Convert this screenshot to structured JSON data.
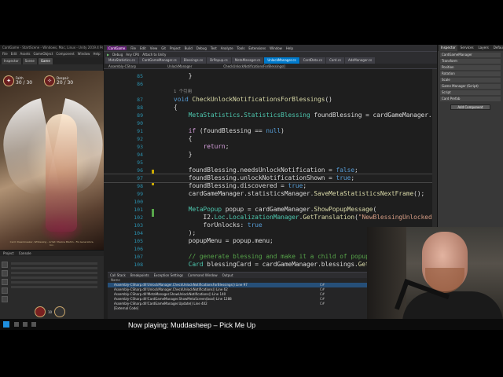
{
  "unity": {
    "title": "CardGame - StartScene - Windows, Mac, Linux - Unity 2019.4 Personal <DX11>",
    "menu": [
      "File",
      "Edit",
      "Assets",
      "GameObject",
      "Component",
      "Window",
      "Help"
    ],
    "tabs": [
      "Inspector",
      "Scene",
      "Game"
    ],
    "hud_left_name": "Faith",
    "hud_left_value": "30 / 30",
    "hud_right_name": "Despair",
    "hud_right_value": "20 / 30",
    "caption": "Card: Dawnbreaker, Whitewing - Artist: Maxine Blahm - FG Generators, Inc.",
    "project_tabs": [
      "Project",
      "Console"
    ],
    "bottom_hud_value": "10"
  },
  "vs": {
    "title_badge": "CardGame",
    "menu": [
      "File",
      "Edit",
      "View",
      "Git",
      "Project",
      "Build",
      "Debug",
      "Test",
      "Analyze",
      "Tools",
      "Extensions",
      "Window",
      "Help"
    ],
    "toolbar": [
      "Debug",
      "Any CPU",
      "Attach to Unity"
    ],
    "doc_tabs": [
      "MetaStatistics.cs",
      "CardGameManager.cs",
      "Blessings.cs",
      "DrPopup.cs",
      "MetaManager.cs",
      "UnlockManager.cs",
      "CardData.cs",
      "Card.cs",
      "AdsManager.cs"
    ],
    "active_doc_tab_index": 5,
    "nav": [
      "Assembly-CSharp",
      "UnlockManager",
      "CheckUnlockNotificationsForBlessings()"
    ],
    "ref_hint": "1 个引用",
    "lines": [
      {
        "n": "85",
        "segs": [
          {
            "c": "",
            "t": "    }"
          }
        ]
      },
      {
        "n": "86",
        "segs": [
          {
            "c": "",
            "t": ""
          }
        ]
      },
      {
        "n": "87",
        "segs": [
          {
            "c": "kw",
            "t": "void "
          },
          {
            "c": "fn",
            "t": "CheckUnlockNotificationsForBlessings"
          },
          {
            "c": "",
            "t": "()"
          }
        ]
      },
      {
        "n": "88",
        "segs": [
          {
            "c": "",
            "t": "{"
          }
        ]
      },
      {
        "n": "89",
        "segs": [
          {
            "c": "",
            "t": "    "
          },
          {
            "c": "ty",
            "t": "MetaStatistics"
          },
          {
            "c": "",
            "t": "."
          },
          {
            "c": "ty",
            "t": "StatisticsBlessing"
          },
          {
            "c": "",
            "t": " foundBlessing = cardGameManager.statisticsMa"
          }
        ]
      },
      {
        "n": "90",
        "segs": [
          {
            "c": "",
            "t": ""
          }
        ]
      },
      {
        "n": "91",
        "segs": [
          {
            "c": "",
            "t": "    "
          },
          {
            "c": "kw2",
            "t": "if"
          },
          {
            "c": "",
            "t": " (foundBlessing == "
          },
          {
            "c": "kw",
            "t": "null"
          },
          {
            "c": "",
            "t": ")"
          }
        ]
      },
      {
        "n": "92",
        "segs": [
          {
            "c": "",
            "t": "    {"
          }
        ]
      },
      {
        "n": "93",
        "segs": [
          {
            "c": "",
            "t": "        "
          },
          {
            "c": "kw2",
            "t": "return"
          },
          {
            "c": "",
            "t": ";"
          }
        ]
      },
      {
        "n": "94",
        "segs": [
          {
            "c": "",
            "t": "    }"
          }
        ]
      },
      {
        "n": "95",
        "segs": [
          {
            "c": "",
            "t": ""
          }
        ]
      },
      {
        "n": "96",
        "segs": [
          {
            "c": "",
            "t": "    foundBlessing.needsUnlockNotification = "
          },
          {
            "c": "kw",
            "t": "false"
          },
          {
            "c": "",
            "t": ";"
          }
        ]
      },
      {
        "n": "97",
        "segs": [
          {
            "c": "",
            "t": "    foundBlessing.unlockNotificationShown = "
          },
          {
            "c": "kw",
            "t": "true"
          },
          {
            "c": "",
            "t": ";"
          }
        ]
      },
      {
        "n": "98",
        "segs": [
          {
            "c": "",
            "t": "    foundBlessing.discovered = "
          },
          {
            "c": "kw",
            "t": "true"
          },
          {
            "c": "",
            "t": ";"
          }
        ]
      },
      {
        "n": "99",
        "segs": [
          {
            "c": "",
            "t": "    cardGameManager.statisticsManager."
          },
          {
            "c": "fn",
            "t": "SaveMetaStatisticsNextFrame"
          },
          {
            "c": "",
            "t": "();"
          }
        ]
      },
      {
        "n": "100",
        "segs": [
          {
            "c": "",
            "t": ""
          }
        ]
      },
      {
        "n": "101",
        "segs": [
          {
            "c": "",
            "t": "    "
          },
          {
            "c": "ty",
            "t": "MetaPopup"
          },
          {
            "c": "",
            "t": " popup = cardGameManager."
          },
          {
            "c": "fn",
            "t": "ShowPopupMessage"
          },
          {
            "c": "",
            "t": "("
          }
        ]
      },
      {
        "n": "102",
        "segs": [
          {
            "c": "",
            "t": "        I2."
          },
          {
            "c": "ty",
            "t": "Loc"
          },
          {
            "c": "",
            "t": "."
          },
          {
            "c": "ty",
            "t": "LocalizationManager"
          },
          {
            "c": "",
            "t": "."
          },
          {
            "c": "fn",
            "t": "GetTranslation"
          },
          {
            "c": "",
            "t": "("
          },
          {
            "c": "st",
            "t": "\"NewBlessingUnlocked\""
          },
          {
            "c": "",
            "t": "),"
          }
        ]
      },
      {
        "n": "103",
        "segs": [
          {
            "c": "",
            "t": "        forUnlocks: "
          },
          {
            "c": "kw",
            "t": "true"
          }
        ]
      },
      {
        "n": "104",
        "segs": [
          {
            "c": "",
            "t": "    );"
          }
        ]
      },
      {
        "n": "105",
        "segs": [
          {
            "c": "",
            "t": "    popupMenu = popup.menu;"
          }
        ]
      },
      {
        "n": "106",
        "segs": [
          {
            "c": "",
            "t": ""
          }
        ]
      },
      {
        "n": "107",
        "segs": [
          {
            "c": "",
            "t": "    "
          },
          {
            "c": "cm",
            "t": "// generate blessing and make it a child of popup"
          }
        ]
      },
      {
        "n": "108",
        "segs": [
          {
            "c": "",
            "t": "    "
          },
          {
            "c": "ty",
            "t": "Card"
          },
          {
            "c": "",
            "t": " blessingCard = cardGameManager.blessings."
          },
          {
            "c": "fn",
            "t": "GetBlessing"
          }
        ]
      }
    ],
    "highlighted_line": "97"
  },
  "callstack": {
    "tabs": [
      "Call Stack",
      "Breakpoints",
      "Exception Settings",
      "Command Window",
      "Output"
    ],
    "header": "Name",
    "rows": [
      {
        "name": "Assembly-CSharp.dll!UnlockManager.CheckUnlockNotificationsForBlessings() Line 97",
        "lang": "C#",
        "sel": true
      },
      {
        "name": "Assembly-CSharp.dll!UnlockManager.CheckUnlockNotifications() Line 62",
        "lang": "C#",
        "sel": false
      },
      {
        "name": "Assembly-CSharp.dll!MetaManager.ShowUnlockNotifications() Line 140",
        "lang": "C#",
        "sel": false
      },
      {
        "name": "Assembly-CSharp.dll!CardGameManager.ShowMetaScreen(bool) Line 1288",
        "lang": "C#",
        "sel": false
      },
      {
        "name": "Assembly-CSharp.dll!CardGameManager.Update() Line 402",
        "lang": "C#",
        "sel": false
      },
      {
        "name": "[External Code]",
        "lang": "",
        "sel": false
      }
    ]
  },
  "inspector": {
    "tabs": [
      "Inspector",
      "Services",
      "Layers",
      "Default"
    ],
    "rows": [
      "CardGameManager",
      "Transform",
      "Position",
      "Rotation",
      "Scale",
      "Game Manager (Script)",
      "Script",
      "Card Prefab"
    ],
    "button": "Add Component"
  },
  "now_playing": "Now playing: Muddasheep – Pick Me Up"
}
